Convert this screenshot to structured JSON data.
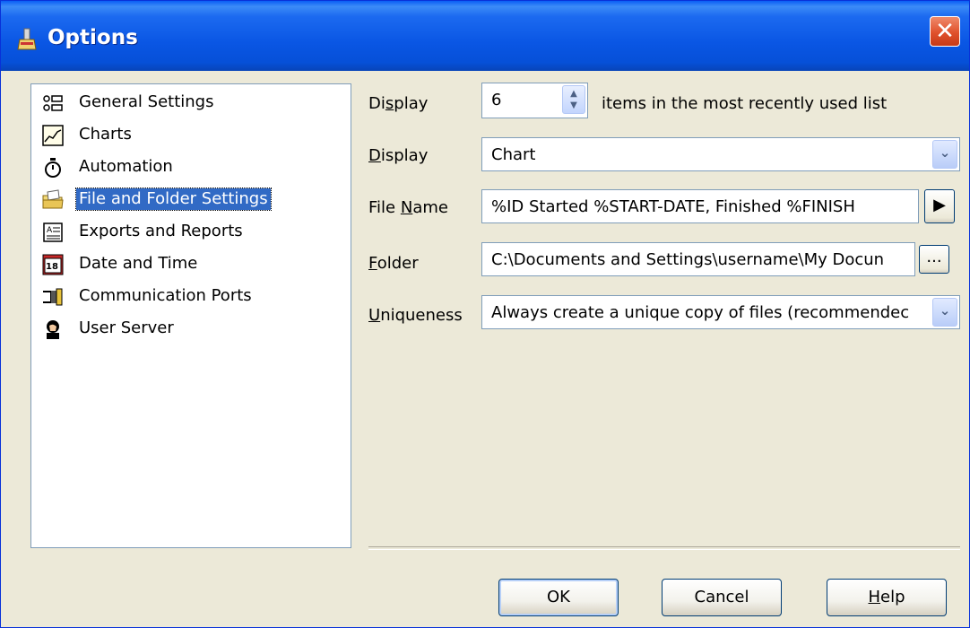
{
  "window": {
    "title": "Options",
    "close_glyph": "✕"
  },
  "tree": {
    "items": [
      {
        "label": "General Settings",
        "icon": "list-icon",
        "selected": false
      },
      {
        "label": "Charts",
        "icon": "chart-icon",
        "selected": false
      },
      {
        "label": "Automation",
        "icon": "stopwatch-icon",
        "selected": false
      },
      {
        "label": "File and Folder Settings",
        "icon": "folder-icon",
        "selected": true
      },
      {
        "label": "Exports and Reports",
        "icon": "report-icon",
        "selected": false
      },
      {
        "label": "Date and Time",
        "icon": "calendar-icon",
        "selected": false
      },
      {
        "label": "Communication Ports",
        "icon": "port-icon",
        "selected": false
      },
      {
        "label": "User Server",
        "icon": "user-icon",
        "selected": false
      }
    ]
  },
  "form": {
    "mru": {
      "label_pre": "Di",
      "label_u": "s",
      "label_post": "play",
      "value": "6",
      "suffix": "items in the most recently used list"
    },
    "display": {
      "label_u": "D",
      "label_post": "isplay",
      "value": "Chart"
    },
    "file_name": {
      "label_pre": "File ",
      "label_u": "N",
      "label_post": "ame",
      "value": "%ID Started %START-DATE, Finished %FINISH",
      "button_glyph": "▶"
    },
    "folder": {
      "label_u": "F",
      "label_post": "older",
      "value": "C:\\Documents and Settings\\username\\My Docun",
      "button_glyph": "..."
    },
    "uniqueness": {
      "label_u": "U",
      "label_post": "niqueness",
      "value": "Always create a unique copy of files (recommendec"
    }
  },
  "buttons": {
    "ok": "OK",
    "cancel": "Cancel",
    "help_u": "H",
    "help_post": "elp"
  }
}
